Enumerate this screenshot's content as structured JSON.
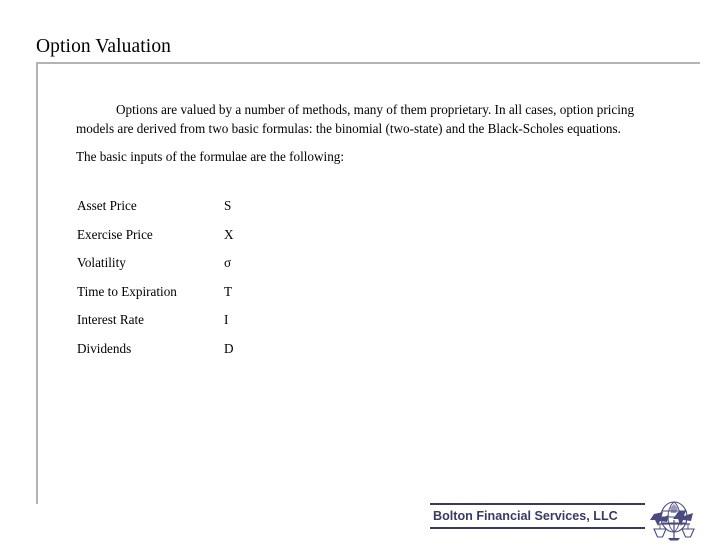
{
  "slide": {
    "title": "Option Valuation",
    "body": {
      "paragraph_1": "Options are valued by a number of methods, many of them proprietary.  In all cases, option pricing models are derived from two basic formulas: the binomial (two-state) and the Black-Scholes equations.",
      "paragraph_2": "The basic inputs of the formulae are the following:"
    },
    "inputs": [
      {
        "label": "Asset Price",
        "symbol": "S"
      },
      {
        "label": "Exercise Price",
        "symbol": "X"
      },
      {
        "label": "Volatility",
        "symbol": "σ"
      },
      {
        "label": "Time to Expiration",
        "symbol": "T"
      },
      {
        "label": "Interest Rate",
        "symbol": "I"
      },
      {
        "label": "Dividends",
        "symbol": "D"
      }
    ],
    "footer": {
      "company": "Bolton Financial Services, LLC",
      "logo_icon": "globe-scales-logo-icon"
    },
    "colors": {
      "rule_gray": "#b3b3b5",
      "footer_navy": "#3a3a66",
      "footer_rule": "#3a3a5c",
      "text": "#000000",
      "background": "#ffffff"
    }
  }
}
